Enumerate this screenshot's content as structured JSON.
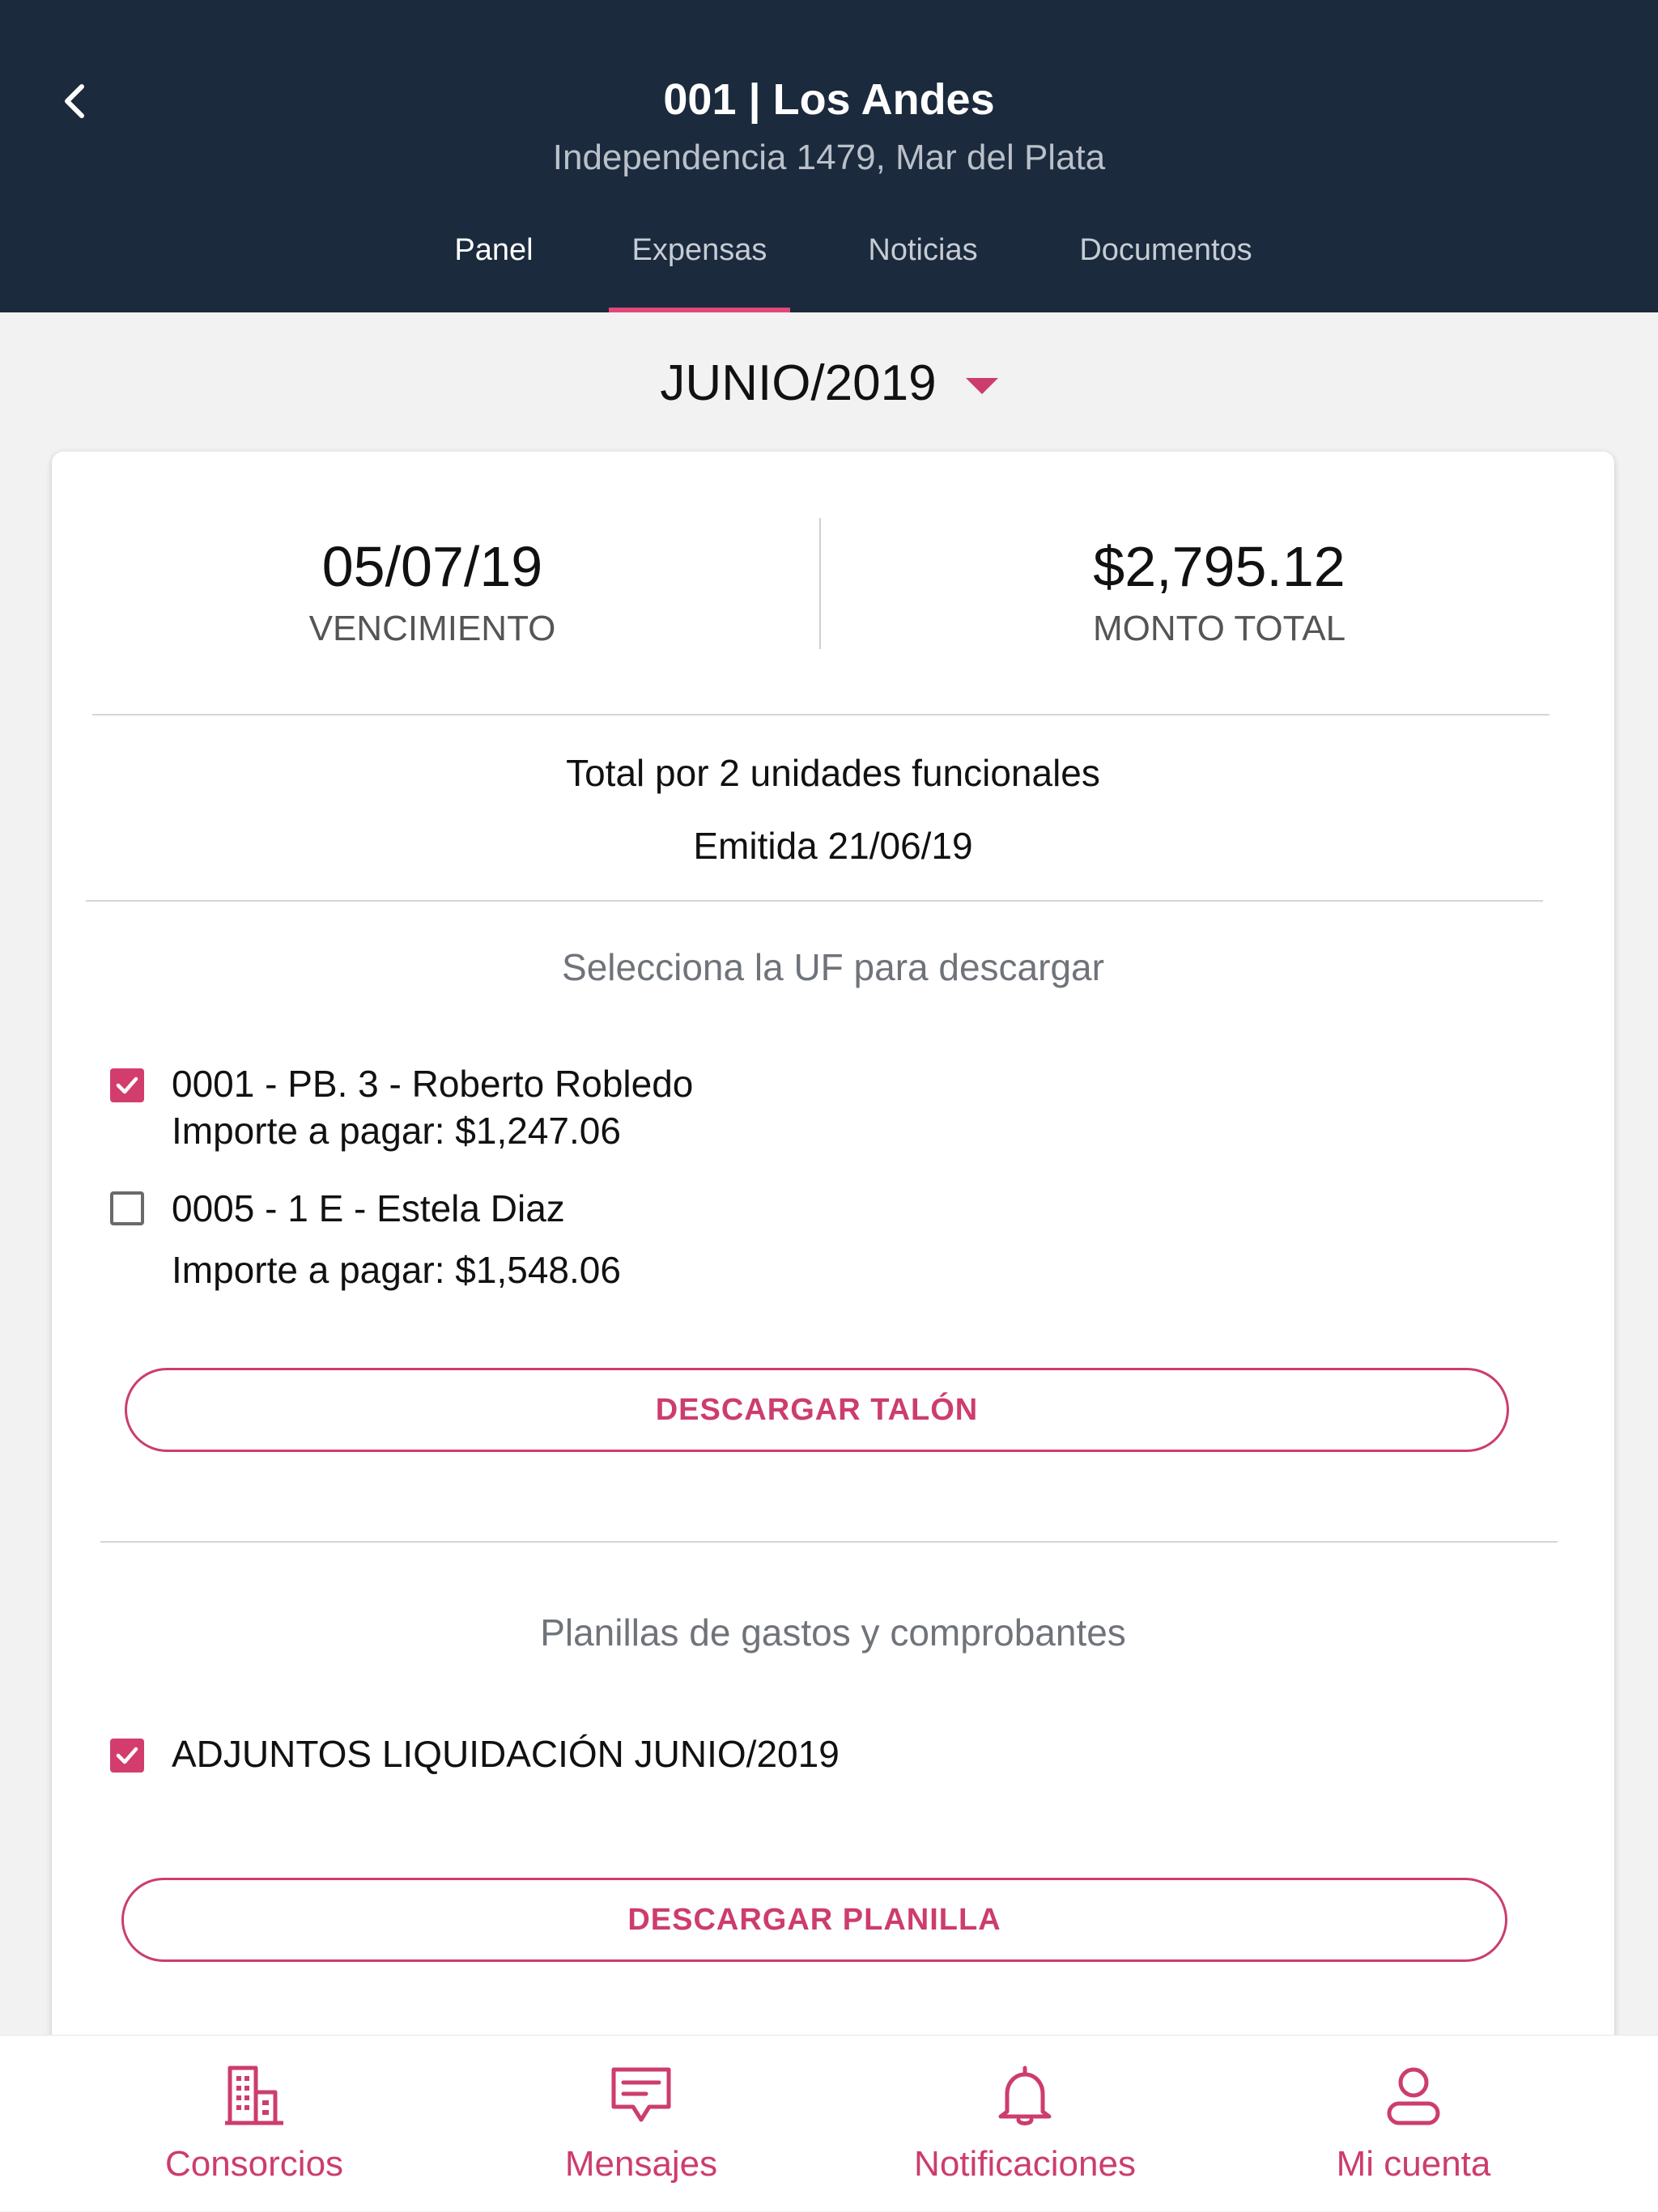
{
  "colors": {
    "header_bg": "#1b2a3c",
    "accent": "#cc3d6d",
    "tab_indicator": "#e0487a"
  },
  "header": {
    "title": "001 | Los Andes",
    "subtitle": "Independencia 1479,  Mar del Plata",
    "tabs": [
      {
        "label": "Panel"
      },
      {
        "label": "Expensas",
        "selected": true
      },
      {
        "label": "Noticias"
      },
      {
        "label": "Documentos"
      }
    ]
  },
  "period": {
    "selected": "JUNIO/2019"
  },
  "summary": {
    "due_date": "05/07/19",
    "due_label": "VENCIMIENTO",
    "total_amount": "$2,795.12",
    "total_label": "MONTO TOTAL",
    "units_text": "Total por 2 unidades funcionales",
    "issued_text": "Emitida 21/06/19"
  },
  "uf_section": {
    "title": "Selecciona la UF para descargar",
    "items": [
      {
        "name": "0001 - PB. 3 - Roberto Robledo",
        "amount": "Importe a pagar: $1,247.06",
        "checked": true
      },
      {
        "name": "0005 - 1 E - Estela Diaz",
        "amount": "Importe a pagar: $1,548.06",
        "checked": false
      }
    ],
    "button_label": "DESCARGAR TALÓN"
  },
  "planillas_section": {
    "title": "Planillas de gastos y comprobantes",
    "items": [
      {
        "name": "ADJUNTOS LIQUIDACIÓN JUNIO/2019",
        "checked": true
      }
    ],
    "button_label": "DESCARGAR PLANILLA"
  },
  "bottom_nav": {
    "items": [
      {
        "label": "Consorcios",
        "icon": "building-icon"
      },
      {
        "label": "Mensajes",
        "icon": "message-icon"
      },
      {
        "label": "Notificaciones",
        "icon": "bell-icon"
      },
      {
        "label": "Mi cuenta",
        "icon": "user-icon"
      }
    ]
  }
}
